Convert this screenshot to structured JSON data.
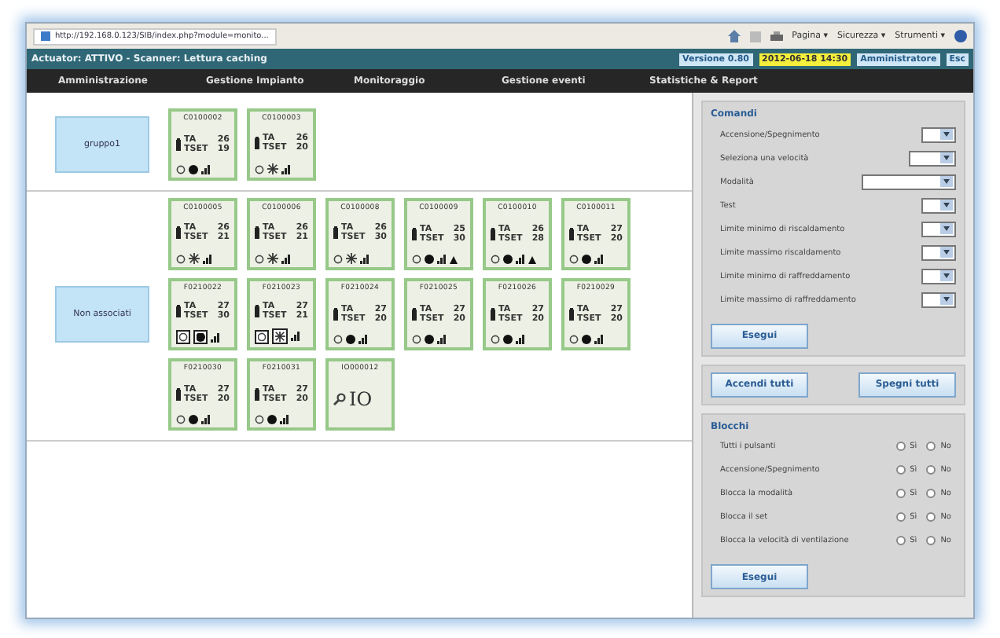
{
  "browser": {
    "tab_title": "http://192.168.0.123/SIB/index.php?module=monito...",
    "tools": [
      "Pagina ▾",
      "Sicurezza ▾",
      "Strumenti ▾"
    ]
  },
  "status_bar": {
    "text": "Actuator: ATTIVO - Scanner: Lettura caching",
    "badges": [
      {
        "text": "Versione 0.80",
        "kind": "info"
      },
      {
        "text": "2012-06-18 14:30",
        "kind": "clock"
      },
      {
        "text": "Amministratore",
        "kind": "info"
      },
      {
        "text": "Esc",
        "kind": "info"
      }
    ]
  },
  "menu": [
    "Amministrazione",
    "Gestione Impianto",
    "Monitoraggio",
    "Gestione eventi",
    "Statistiche & Report"
  ],
  "groups": [
    {
      "name": "gruppo1",
      "devices": [
        {
          "kind": "device",
          "id": "C0100002",
          "ta_label": "TA",
          "ta": "26",
          "tset_label": "TSET",
          "tset": "19",
          "cooling": false,
          "warning": false,
          "boxed": false
        },
        {
          "kind": "device",
          "id": "C0100003",
          "ta_label": "TA",
          "ta": "26",
          "tset_label": "TSET",
          "tset": "20",
          "cooling": true,
          "warning": false,
          "boxed": false
        }
      ]
    },
    {
      "name": "Non associati",
      "devices": [
        {
          "kind": "device",
          "id": "C0100005",
          "ta_label": "TA",
          "ta": "26",
          "tset_label": "TSET",
          "tset": "21",
          "cooling": true,
          "warning": false,
          "boxed": false
        },
        {
          "kind": "device",
          "id": "C0100006",
          "ta_label": "TA",
          "ta": "26",
          "tset_label": "TSET",
          "tset": "21",
          "cooling": true,
          "warning": false,
          "boxed": false
        },
        {
          "kind": "device",
          "id": "C0100008",
          "ta_label": "TA",
          "ta": "26",
          "tset_label": "TSET",
          "tset": "30",
          "cooling": true,
          "warning": false,
          "boxed": false
        },
        {
          "kind": "device",
          "id": "C0100009",
          "ta_label": "TA",
          "ta": "25",
          "tset_label": "TSET",
          "tset": "30",
          "cooling": false,
          "warning": true,
          "boxed": false
        },
        {
          "kind": "device",
          "id": "C0100010",
          "ta_label": "TA",
          "ta": "26",
          "tset_label": "TSET",
          "tset": "28",
          "cooling": false,
          "warning": true,
          "boxed": false
        },
        {
          "kind": "device",
          "id": "C0100011",
          "ta_label": "TA",
          "ta": "27",
          "tset_label": "TSET",
          "tset": "20",
          "cooling": false,
          "warning": false,
          "boxed": false
        },
        {
          "kind": "device",
          "id": "F0210022",
          "ta_label": "TA",
          "ta": "27",
          "tset_label": "TSET",
          "tset": "30",
          "cooling": false,
          "warning": false,
          "boxed": true
        },
        {
          "kind": "device",
          "id": "F0210023",
          "ta_label": "TA",
          "ta": "27",
          "tset_label": "TSET",
          "tset": "21",
          "cooling": true,
          "warning": false,
          "boxed": true
        },
        {
          "kind": "device",
          "id": "F0210024",
          "ta_label": "TA",
          "ta": "27",
          "tset_label": "TSET",
          "tset": "20",
          "cooling": false,
          "warning": false,
          "boxed": false
        },
        {
          "kind": "device",
          "id": "F0210025",
          "ta_label": "TA",
          "ta": "27",
          "tset_label": "TSET",
          "tset": "20",
          "cooling": false,
          "warning": false,
          "boxed": false
        },
        {
          "kind": "device",
          "id": "F0210026",
          "ta_label": "TA",
          "ta": "27",
          "tset_label": "TSET",
          "tset": "20",
          "cooling": false,
          "warning": false,
          "boxed": false
        },
        {
          "kind": "device",
          "id": "F0210029",
          "ta_label": "TA",
          "ta": "27",
          "tset_label": "TSET",
          "tset": "20",
          "cooling": false,
          "warning": false,
          "boxed": false
        },
        {
          "kind": "device",
          "id": "F0210030",
          "ta_label": "TA",
          "ta": "27",
          "tset_label": "TSET",
          "tset": "20",
          "cooling": false,
          "warning": false,
          "boxed": false
        },
        {
          "kind": "device",
          "id": "F0210031",
          "ta_label": "TA",
          "ta": "27",
          "tset_label": "TSET",
          "tset": "20",
          "cooling": false,
          "warning": false,
          "boxed": false
        },
        {
          "kind": "io",
          "id": "IO000012",
          "label": "IO"
        }
      ]
    }
  ],
  "commands": {
    "title": "Comandi",
    "rows": [
      {
        "label": "Accensione/Spegnimento",
        "kind": "small"
      },
      {
        "label": "Seleziona una velocità",
        "kind": "medium"
      },
      {
        "label": "Modalità",
        "kind": "wide"
      },
      {
        "label": "Test",
        "kind": "small"
      },
      {
        "label": "Limite minimo di riscaldamento",
        "kind": "small"
      },
      {
        "label": "Limite massimo riscaldamento",
        "kind": "small"
      },
      {
        "label": "Limite minimo di raffreddamento",
        "kind": "small"
      },
      {
        "label": "Limite massimo di raffreddamento",
        "kind": "small"
      }
    ],
    "button": "Esegui"
  },
  "all_buttons": [
    "Accendi tutti",
    "Spegni tutti"
  ],
  "locks": {
    "title": "Blocchi",
    "rows": [
      {
        "label": "Tutti i pulsanti",
        "options": [
          {
            "label": "Sì",
            "selected": false
          },
          {
            "label": "No",
            "selected": false
          }
        ]
      },
      {
        "label": "Accensione/Spegnimento",
        "options": [
          {
            "label": "Sì",
            "selected": false
          },
          {
            "label": "No",
            "selected": false
          }
        ]
      },
      {
        "label": "Blocca la modalità",
        "options": [
          {
            "label": "Sì",
            "selected": false
          },
          {
            "label": "No",
            "selected": false
          }
        ]
      },
      {
        "label": "Blocca il set",
        "options": [
          {
            "label": "Sì",
            "selected": false
          },
          {
            "label": "No",
            "selected": false
          }
        ]
      },
      {
        "label": "Blocca la velocità di ventilazione",
        "options": [
          {
            "label": "Sì",
            "selected": false
          },
          {
            "label": "No",
            "selected": false
          }
        ]
      }
    ],
    "button": "Esegui"
  }
}
